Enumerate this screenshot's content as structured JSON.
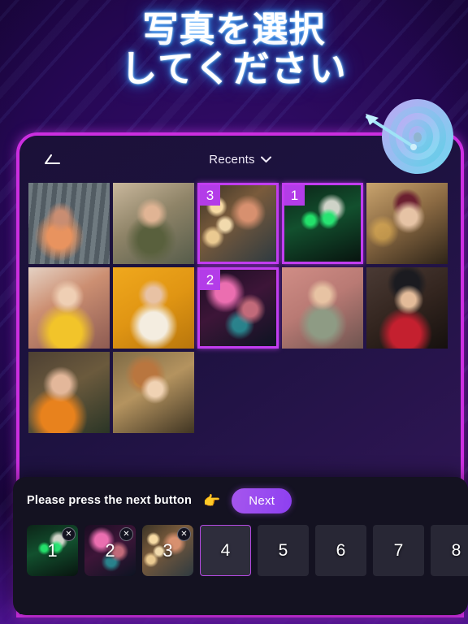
{
  "headline": {
    "line1": "写真を選択",
    "line2": "してください"
  },
  "decor": {
    "target_icon": "dartboard-target-icon",
    "arrow_icon": "dart-arrow-icon"
  },
  "app": {
    "back_icon": "back-arrow-icon",
    "album_label": "Recents",
    "album_chevron_icon": "chevron-down-icon"
  },
  "gallery": {
    "photos": [
      {
        "art": "p-a",
        "selected": false,
        "badge": ""
      },
      {
        "art": "p-b",
        "selected": false,
        "badge": ""
      },
      {
        "art": "p-c",
        "selected": true,
        "badge": "3"
      },
      {
        "art": "p-d",
        "selected": true,
        "badge": "1"
      },
      {
        "art": "p-e",
        "selected": false,
        "badge": ""
      },
      {
        "art": "p-f",
        "selected": false,
        "badge": ""
      },
      {
        "art": "p-g",
        "selected": false,
        "badge": ""
      },
      {
        "art": "p-h",
        "selected": true,
        "badge": "2"
      },
      {
        "art": "p-i",
        "selected": false,
        "badge": ""
      },
      {
        "art": "p-j",
        "selected": false,
        "badge": ""
      },
      {
        "art": "p-k",
        "selected": false,
        "badge": ""
      },
      {
        "art": "p-l",
        "selected": false,
        "badge": ""
      }
    ]
  },
  "panel": {
    "hint_text": "Please press the next button",
    "pointer_icon": "👉",
    "next_label": "Next",
    "slots": [
      {
        "num": "1",
        "filled": true,
        "active": false,
        "art": "p-d",
        "remove_label": "✕"
      },
      {
        "num": "2",
        "filled": true,
        "active": false,
        "art": "p-h",
        "remove_label": "✕"
      },
      {
        "num": "3",
        "filled": true,
        "active": false,
        "art": "p-c",
        "remove_label": "✕"
      },
      {
        "num": "4",
        "filled": false,
        "active": true,
        "art": "",
        "remove_label": ""
      },
      {
        "num": "5",
        "filled": false,
        "active": false,
        "art": "",
        "remove_label": ""
      },
      {
        "num": "6",
        "filled": false,
        "active": false,
        "art": "",
        "remove_label": ""
      },
      {
        "num": "7",
        "filled": false,
        "active": false,
        "art": "",
        "remove_label": ""
      },
      {
        "num": "8",
        "filled": false,
        "active": false,
        "art": "",
        "remove_label": ""
      }
    ]
  },
  "colors": {
    "accent_pink": "#cc2ee0",
    "accent_purple": "#b33ce8",
    "bg_purple": "#2d0a60",
    "panel_dark": "#141221",
    "headline_glow": "#49a8ff"
  }
}
